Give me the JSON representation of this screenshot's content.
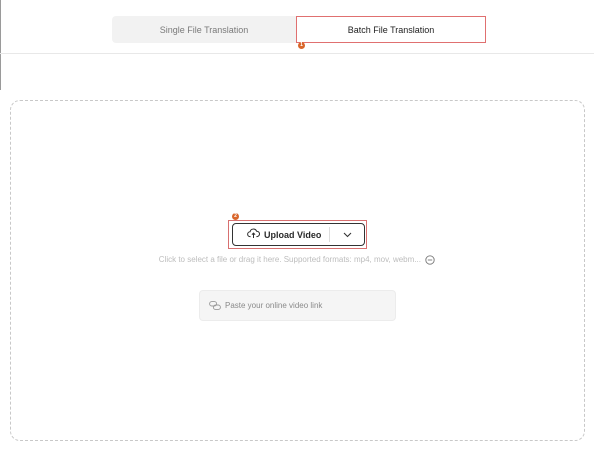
{
  "tabs": [
    {
      "label": "Single File Translation",
      "active": false
    },
    {
      "label": "Batch File Translation",
      "active": true
    }
  ],
  "steps": {
    "tabs_badge": "1",
    "upload_badge": "2"
  },
  "upload": {
    "button_label": "Upload Video",
    "upload_icon": "cloud-upload-icon",
    "dropdown_icon": "chevron-down-icon",
    "hint": "Click to select a file or drag it here. Supported formats: mp4, mov, webm...",
    "more_formats_icon": "more-circle-icon"
  },
  "link_input": {
    "placeholder": "Paste your online video link",
    "icon": "link-icon"
  },
  "colors": {
    "highlight_outline": "#e07070",
    "step_badge": "#d9662b",
    "active_tab_bg": "#ffffff",
    "inactive_tab_bg": "#f2f2f2"
  }
}
